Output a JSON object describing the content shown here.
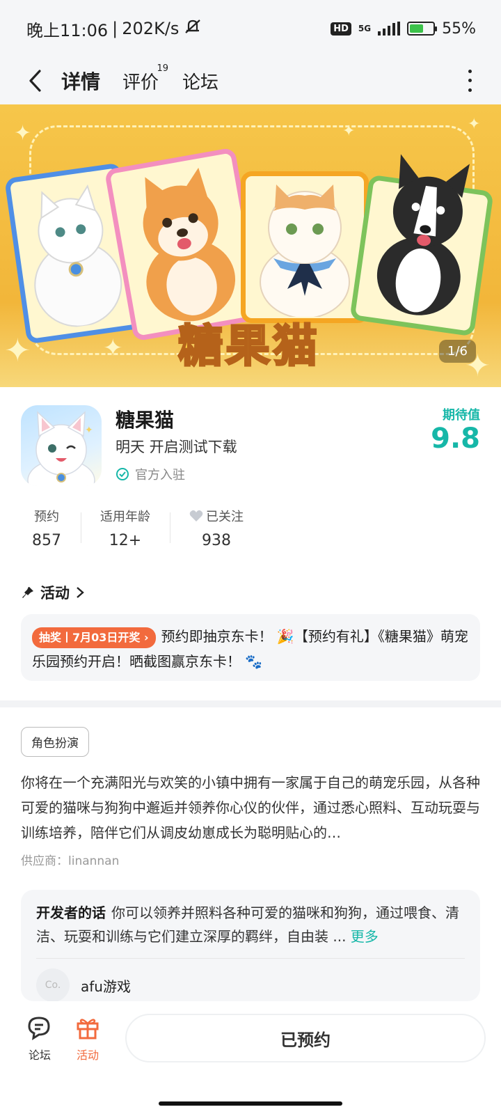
{
  "status_bar": {
    "time": "晚上11:06",
    "speed": "202K/s",
    "hd": "HD",
    "network": "5G",
    "battery": "55%"
  },
  "nav": {
    "tabs": [
      {
        "label": "详情",
        "active": true
      },
      {
        "label": "评价",
        "badge": "19"
      },
      {
        "label": "论坛"
      }
    ]
  },
  "banner": {
    "title": "糖果猫",
    "page_indicator": "1/6"
  },
  "app": {
    "name": "糖果猫",
    "release": "明天 开启测试下载",
    "official": "官方入驻",
    "expect_label": "期待值",
    "expect_value": "9.8"
  },
  "stats": [
    {
      "label": "预约",
      "value": "857"
    },
    {
      "label": "适用年龄",
      "value": "12+"
    },
    {
      "label": "已关注",
      "value": "938"
    }
  ],
  "activity": {
    "heading": "活动",
    "tag": "抽奖丨7月03日开奖",
    "text": "预约即抽京东卡！ 🎉【预约有礼】《糖果猫》萌宠乐园预约开启！晒截图赢京东卡！ 🐾"
  },
  "genre": "角色扮演",
  "description": "你将在一个充满阳光与欢笑的小镇中拥有一家属于自己的萌宠乐园，从各种可爱的猫咪与狗狗中邂逅并领养你心仪的伙伴，通过悉心照料、互动玩耍与训练培养，陪伴它们从调皮幼崽成长为聪明贴心的…",
  "supplier": "供应商：linannan",
  "developer": {
    "label": "开发者的话",
    "text": "你可以领养并照料各种可爱的猫咪和狗狗，通过喂食、清洁、玩耍和训练与它们建立深厚的羁绊，自由装 ...",
    "more": "更多",
    "avatar_text": "Co.",
    "name": "afu游戏"
  },
  "bottom": {
    "forum": "论坛",
    "activity": "活动",
    "reserve": "已预约"
  },
  "colors": {
    "accent": "#16c9b8",
    "orange": "#f26a3d",
    "banner": "#f6c64a"
  }
}
